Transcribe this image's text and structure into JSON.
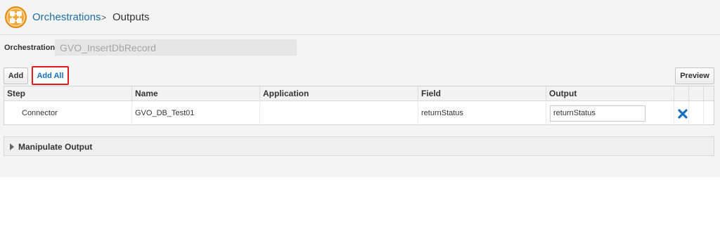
{
  "breadcrumb": {
    "parent": "Orchestrations",
    "separator": ">",
    "current": "Outputs"
  },
  "orchestration": {
    "label": "Orchestration",
    "value": "GVO_InsertDbRecord"
  },
  "toolbar": {
    "add_label": "Add",
    "add_all_label": "Add All",
    "preview_label": "Preview"
  },
  "table": {
    "columns": [
      "Step",
      "Name",
      "Application",
      "Field",
      "Output"
    ],
    "rows": [
      {
        "step": "Connector",
        "name": "GVO_DB_Test01",
        "application": "",
        "field": "returnStatus",
        "output": "returnStatus"
      }
    ]
  },
  "manipulate": {
    "label": "Manipulate Output"
  },
  "icons": {
    "logo": "orchestration-logo-icon",
    "delete": "delete-x-icon",
    "expand": "expand-triangle-icon"
  },
  "colors": {
    "link": "#1d6fa5",
    "highlight_border": "#e11a1a",
    "delete_icon": "#1570c0",
    "logo": "#f2a93b"
  }
}
